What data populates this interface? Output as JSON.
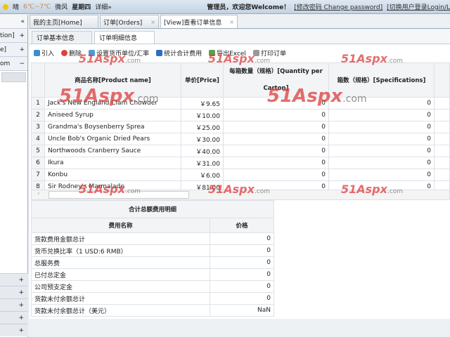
{
  "topbar": {
    "weather": "晴",
    "temp": "6℃~7℃",
    "wind": "微风",
    "weekday": "星期四",
    "details": "详细»",
    "welcome": "管理员，欢迎您Welcome！",
    "change_password": "[修改密码 Change password]",
    "switch_user": "[切换用户登录Login/L"
  },
  "sidebar": {
    "items": [
      "tion]",
      "e]",
      "om"
    ],
    "item_icons": [
      "+",
      "+",
      "−"
    ],
    "bottom_icons": [
      "+",
      "+",
      "+",
      "+",
      "+"
    ]
  },
  "tabs": [
    {
      "label": "我的主页[Home]"
    },
    {
      "label": "订单[Orders]"
    },
    {
      "label": "[View]查看订单信息"
    }
  ],
  "subtabs": [
    {
      "label": "订单基本信息"
    },
    {
      "label": "订单明细信息"
    }
  ],
  "toolbar": {
    "import": "引入",
    "delete": "删除",
    "set_currency": "设置货币单位/汇率",
    "stat": "统计合计费用",
    "export": "导出Excel",
    "print": "打印订单"
  },
  "grid": {
    "headers": [
      "商品名称[Product name]",
      "单价[Price]",
      "每箱数量（规格）[Quantity per Carton]",
      "箱数（规格）[Specifications]"
    ],
    "rows": [
      {
        "n": "1",
        "name": "Jack's New England Clam Chowder",
        "price": "￥9.65",
        "qty": "0",
        "spec": "0"
      },
      {
        "n": "2",
        "name": "Aniseed Syrup",
        "price": "￥10.00",
        "qty": "0",
        "spec": "0"
      },
      {
        "n": "3",
        "name": "Grandma's Boysenberry Sprea",
        "price": "￥25.00",
        "qty": "0",
        "spec": "0"
      },
      {
        "n": "4",
        "name": "Uncle Bob's Organic Dried Pears",
        "price": "￥30.00",
        "qty": "0",
        "spec": "0"
      },
      {
        "n": "5",
        "name": "Northwoods Cranberry Sauce",
        "price": "￥40.00",
        "qty": "0",
        "spec": "0"
      },
      {
        "n": "6",
        "name": "Ikura",
        "price": "￥31.00",
        "qty": "0",
        "spec": "0"
      },
      {
        "n": "7",
        "name": "Konbu",
        "price": "￥6.00",
        "qty": "0",
        "spec": "0"
      },
      {
        "n": "8",
        "name": "Sir Rodney's Marmalade",
        "price": "￥81.00",
        "qty": "0",
        "spec": "0"
      }
    ]
  },
  "summary": {
    "title": "合计总额费用明细",
    "col_name": "费用名称",
    "col_price": "价格",
    "rows": [
      {
        "name": "货款费用金额总计",
        "value": "0"
      },
      {
        "name": "货币兑换比率（1 USD:6 RMB）",
        "value": "0"
      },
      {
        "name": "总服务费",
        "value": "0"
      },
      {
        "name": "已付总定金",
        "value": "0"
      },
      {
        "name": "公司预支定金",
        "value": "0"
      },
      {
        "name": "货款未付余额总计",
        "value": "0"
      },
      {
        "name": "货款未付余额总计（美元）",
        "value": "NaN"
      }
    ]
  },
  "watermark": {
    "text": "51Aspx",
    ".com": ".com"
  }
}
